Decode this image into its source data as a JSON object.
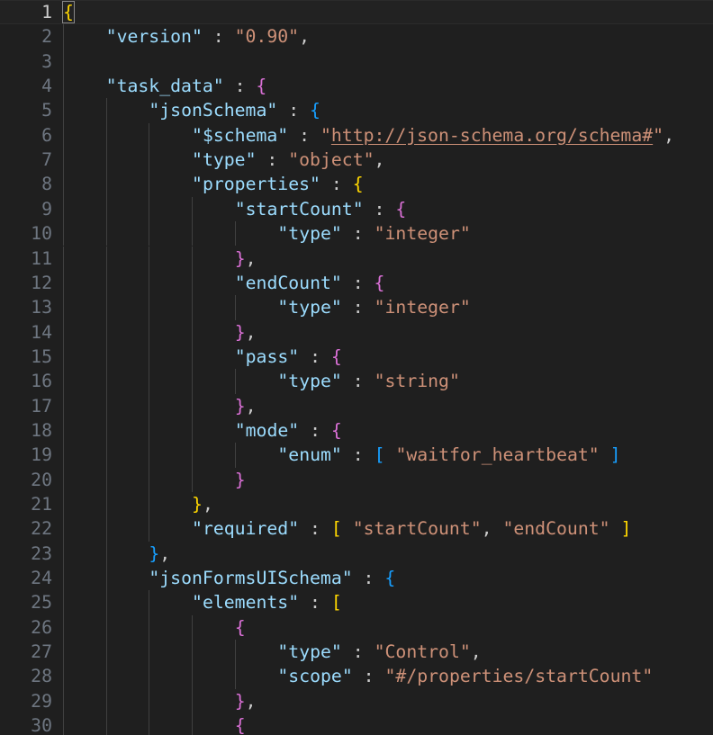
{
  "lines": [
    {
      "n": "1",
      "indent": 0,
      "active": true,
      "tokens": [
        {
          "t": "{",
          "c": "b1"
        }
      ]
    },
    {
      "n": "2",
      "indent": 1,
      "tokens": [
        {
          "t": "\"version\"",
          "c": "k"
        },
        {
          "t": " : ",
          "c": "p"
        },
        {
          "t": "\"0.90\"",
          "c": "s"
        },
        {
          "t": ",",
          "c": "p"
        }
      ]
    },
    {
      "n": "3",
      "indent": 1,
      "tokens": []
    },
    {
      "n": "4",
      "indent": 1,
      "tokens": [
        {
          "t": "\"task_data\"",
          "c": "k"
        },
        {
          "t": " : ",
          "c": "p"
        },
        {
          "t": "{",
          "c": "b2"
        }
      ]
    },
    {
      "n": "5",
      "indent": 2,
      "tokens": [
        {
          "t": "\"jsonSchema\"",
          "c": "k"
        },
        {
          "t": " : ",
          "c": "p"
        },
        {
          "t": "{",
          "c": "b3"
        }
      ]
    },
    {
      "n": "6",
      "indent": 3,
      "tokens": [
        {
          "t": "\"$schema\"",
          "c": "k"
        },
        {
          "t": " : ",
          "c": "p"
        },
        {
          "t": "\"",
          "c": "s"
        },
        {
          "t": "http://json-schema.org/schema#",
          "c": "s url"
        },
        {
          "t": "\"",
          "c": "s"
        },
        {
          "t": ",",
          "c": "p"
        }
      ]
    },
    {
      "n": "7",
      "indent": 3,
      "tokens": [
        {
          "t": "\"type\"",
          "c": "k"
        },
        {
          "t": " : ",
          "c": "p"
        },
        {
          "t": "\"object\"",
          "c": "s"
        },
        {
          "t": ",",
          "c": "p"
        }
      ]
    },
    {
      "n": "8",
      "indent": 3,
      "tokens": [
        {
          "t": "\"properties\"",
          "c": "k"
        },
        {
          "t": " : ",
          "c": "p"
        },
        {
          "t": "{",
          "c": "b1"
        }
      ]
    },
    {
      "n": "9",
      "indent": 4,
      "tokens": [
        {
          "t": "\"startCount\"",
          "c": "k"
        },
        {
          "t": " : ",
          "c": "p"
        },
        {
          "t": "{",
          "c": "b2"
        }
      ]
    },
    {
      "n": "10",
      "indent": 5,
      "tokens": [
        {
          "t": "\"type\"",
          "c": "k"
        },
        {
          "t": " : ",
          "c": "p"
        },
        {
          "t": "\"integer\"",
          "c": "s"
        }
      ]
    },
    {
      "n": "11",
      "indent": 4,
      "tokens": [
        {
          "t": "}",
          "c": "b2"
        },
        {
          "t": ",",
          "c": "p"
        }
      ]
    },
    {
      "n": "12",
      "indent": 4,
      "tokens": [
        {
          "t": "\"endCount\"",
          "c": "k"
        },
        {
          "t": " : ",
          "c": "p"
        },
        {
          "t": "{",
          "c": "b2"
        }
      ]
    },
    {
      "n": "13",
      "indent": 5,
      "tokens": [
        {
          "t": "\"type\"",
          "c": "k"
        },
        {
          "t": " : ",
          "c": "p"
        },
        {
          "t": "\"integer\"",
          "c": "s"
        }
      ]
    },
    {
      "n": "14",
      "indent": 4,
      "tokens": [
        {
          "t": "}",
          "c": "b2"
        },
        {
          "t": ",",
          "c": "p"
        }
      ]
    },
    {
      "n": "15",
      "indent": 4,
      "tokens": [
        {
          "t": "\"pass\"",
          "c": "k"
        },
        {
          "t": " : ",
          "c": "p"
        },
        {
          "t": "{",
          "c": "b2"
        }
      ]
    },
    {
      "n": "16",
      "indent": 5,
      "tokens": [
        {
          "t": "\"type\"",
          "c": "k"
        },
        {
          "t": " : ",
          "c": "p"
        },
        {
          "t": "\"string\"",
          "c": "s"
        }
      ]
    },
    {
      "n": "17",
      "indent": 4,
      "tokens": [
        {
          "t": "}",
          "c": "b2"
        },
        {
          "t": ",",
          "c": "p"
        }
      ]
    },
    {
      "n": "18",
      "indent": 4,
      "tokens": [
        {
          "t": "\"mode\"",
          "c": "k"
        },
        {
          "t": " : ",
          "c": "p"
        },
        {
          "t": "{",
          "c": "b2"
        }
      ]
    },
    {
      "n": "19",
      "indent": 5,
      "tokens": [
        {
          "t": "\"enum\"",
          "c": "k"
        },
        {
          "t": " : ",
          "c": "p"
        },
        {
          "t": "[",
          "c": "b3"
        },
        {
          "t": " ",
          "c": "p"
        },
        {
          "t": "\"waitfor_heartbeat\"",
          "c": "s"
        },
        {
          "t": " ",
          "c": "p"
        },
        {
          "t": "]",
          "c": "b3"
        }
      ]
    },
    {
      "n": "20",
      "indent": 4,
      "tokens": [
        {
          "t": "}",
          "c": "b2"
        }
      ]
    },
    {
      "n": "21",
      "indent": 3,
      "tokens": [
        {
          "t": "}",
          "c": "b1"
        },
        {
          "t": ",",
          "c": "p"
        }
      ]
    },
    {
      "n": "22",
      "indent": 3,
      "tokens": [
        {
          "t": "\"required\"",
          "c": "k"
        },
        {
          "t": " : ",
          "c": "p"
        },
        {
          "t": "[",
          "c": "b1"
        },
        {
          "t": " ",
          "c": "p"
        },
        {
          "t": "\"startCount\"",
          "c": "s"
        },
        {
          "t": ", ",
          "c": "p"
        },
        {
          "t": "\"endCount\"",
          "c": "s"
        },
        {
          "t": " ",
          "c": "p"
        },
        {
          "t": "]",
          "c": "b1"
        }
      ]
    },
    {
      "n": "23",
      "indent": 2,
      "tokens": [
        {
          "t": "}",
          "c": "b3"
        },
        {
          "t": ",",
          "c": "p"
        }
      ]
    },
    {
      "n": "24",
      "indent": 2,
      "tokens": [
        {
          "t": "\"jsonFormsUISchema\"",
          "c": "k"
        },
        {
          "t": " : ",
          "c": "p"
        },
        {
          "t": "{",
          "c": "b3"
        }
      ]
    },
    {
      "n": "25",
      "indent": 3,
      "tokens": [
        {
          "t": "\"elements\"",
          "c": "k"
        },
        {
          "t": " : ",
          "c": "p"
        },
        {
          "t": "[",
          "c": "b1"
        }
      ]
    },
    {
      "n": "26",
      "indent": 4,
      "tokens": [
        {
          "t": "{",
          "c": "b2"
        }
      ]
    },
    {
      "n": "27",
      "indent": 5,
      "tokens": [
        {
          "t": "\"type\"",
          "c": "k"
        },
        {
          "t": " : ",
          "c": "p"
        },
        {
          "t": "\"Control\"",
          "c": "s"
        },
        {
          "t": ",",
          "c": "p"
        }
      ]
    },
    {
      "n": "28",
      "indent": 5,
      "tokens": [
        {
          "t": "\"scope\"",
          "c": "k"
        },
        {
          "t": " : ",
          "c": "p"
        },
        {
          "t": "\"#/properties/startCount\"",
          "c": "s"
        }
      ]
    },
    {
      "n": "29",
      "indent": 4,
      "tokens": [
        {
          "t": "}",
          "c": "b2"
        },
        {
          "t": ",",
          "c": "p"
        }
      ]
    },
    {
      "n": "30",
      "indent": 4,
      "tokens": [
        {
          "t": "{",
          "c": "b2"
        }
      ]
    }
  ]
}
